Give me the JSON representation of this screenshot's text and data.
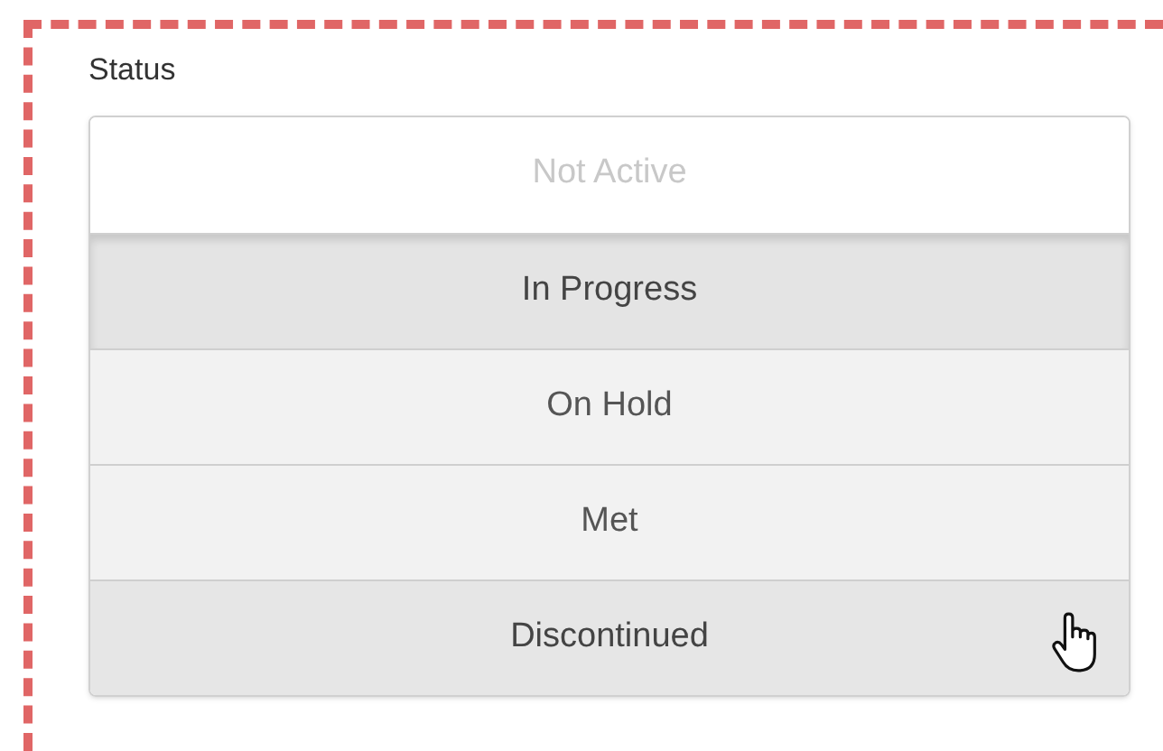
{
  "field": {
    "label": "Status"
  },
  "options": [
    {
      "label": "Not Active",
      "disabled": true,
      "selected": false,
      "hovered": false
    },
    {
      "label": "In Progress",
      "disabled": false,
      "selected": true,
      "hovered": false
    },
    {
      "label": "On Hold",
      "disabled": false,
      "selected": false,
      "hovered": false
    },
    {
      "label": "Met",
      "disabled": false,
      "selected": false,
      "hovered": false
    },
    {
      "label": "Discontinued",
      "disabled": false,
      "selected": false,
      "hovered": true
    }
  ]
}
